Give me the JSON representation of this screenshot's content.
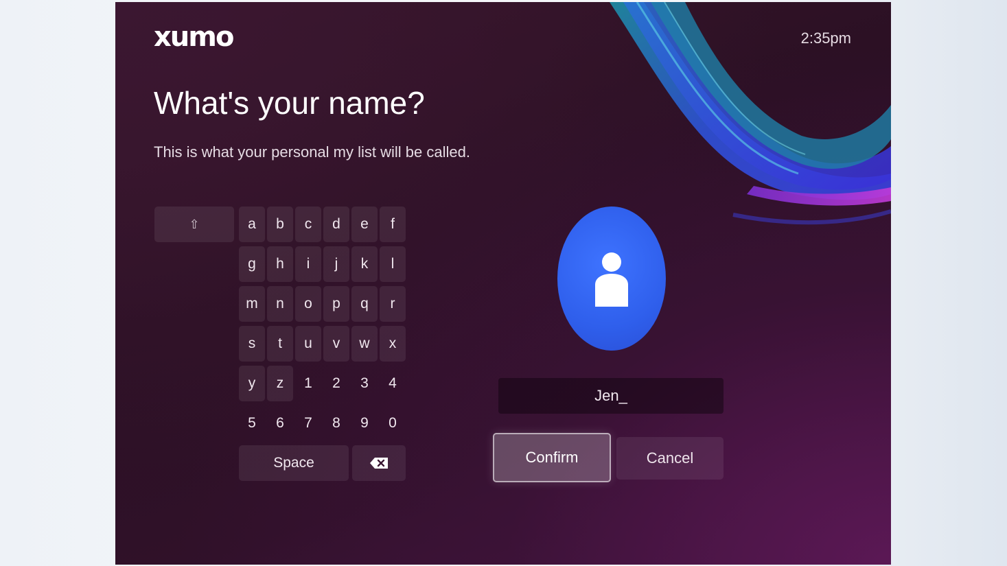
{
  "app": {
    "logo_text": "xumo",
    "clock": "2:35pm"
  },
  "page": {
    "title": "What's your name?",
    "subtitle": "This is what your personal my list will be called."
  },
  "keyboard": {
    "shift_icon": "shift-arrow-icon",
    "shift_glyph": "⇧",
    "rows": [
      [
        "a",
        "b",
        "c",
        "d",
        "e",
        "f"
      ],
      [
        "g",
        "h",
        "i",
        "j",
        "k",
        "l"
      ],
      [
        "m",
        "n",
        "o",
        "p",
        "q",
        "r"
      ],
      [
        "s",
        "t",
        "u",
        "v",
        "w",
        "x"
      ],
      [
        "y",
        "z",
        "1",
        "2",
        "3",
        "4"
      ],
      [
        "5",
        "6",
        "7",
        "8",
        "9",
        "0"
      ]
    ],
    "space_label": "Space",
    "backspace_icon": "backspace-icon"
  },
  "profile": {
    "avatar_icon": "person-icon",
    "avatar_color": "#3366f5",
    "name_value": "Jen_"
  },
  "actions": {
    "confirm_label": "Confirm",
    "cancel_label": "Cancel"
  }
}
